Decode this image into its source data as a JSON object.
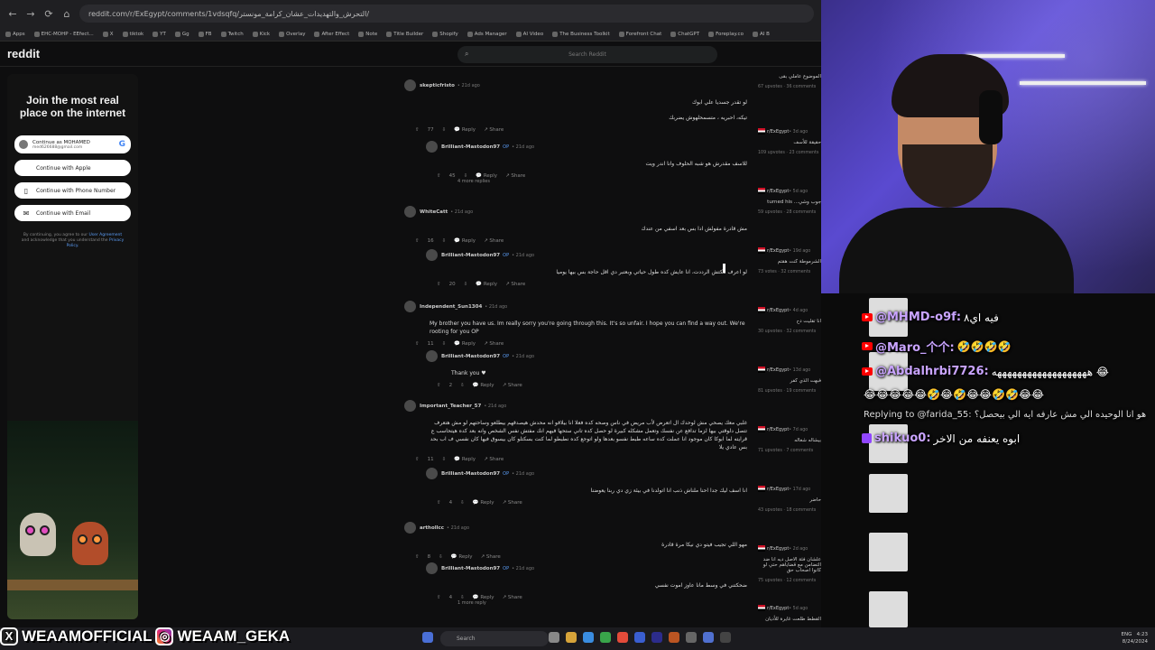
{
  "browser": {
    "url": "reddit.com/r/ExEgypt/comments/1vdsqfq/التحرش_والتهديدات_عشان_كرامة_مونستر/",
    "bookmarks": [
      "Apps",
      "EHC-MOHP - EEfect...",
      "X",
      "tiktok",
      "YT",
      "Gg",
      "FB",
      "Twitch",
      "Kick",
      "Overlay",
      "After Effect",
      "Note",
      "Title Builder",
      "Shopify",
      "Ads Manager",
      "AI Video",
      "The Business Toolkit",
      "Forefront Chat",
      "ChatGPT",
      "Foreplay.co",
      "AI B"
    ]
  },
  "reddit": {
    "logo": "reddit",
    "search_placeholder": "Search Reddit",
    "join": {
      "title": "Join the most real place on the internet",
      "google_name": "Continue as MOHAMED",
      "google_email": "med626688@gmail.com",
      "apple": "Continue with Apple",
      "phone": "Continue with Phone Number",
      "email": "Continue with Email",
      "terms_1": "By continuing, you agree to our",
      "terms_user": "User Agreement",
      "terms_2": "and acknowledge that you understand the",
      "terms_privacy": "Privacy Policy."
    },
    "comments": [
      {
        "user": "skepticfristo",
        "time": "• 21d ago",
        "body": "لو تقدر جسديا علي ابوك",
        "body2": "تيكه، احبريه ، متسمحلهوش يضربك",
        "votes": "77",
        "reply_label": "Reply",
        "share_label": "Share",
        "reply": {
          "user": "Brilliant-Mastodon97",
          "op": "OP",
          "time": "• 21d ago",
          "body": "للاسف مقدرش هو شبه الحلوف وانا اندر ويت",
          "votes": "45",
          "more": "4 more replies"
        }
      },
      {
        "user": "WhiteCatt",
        "time": "• 21d ago",
        "body": "مش قادرة مفولش ادا بس بعد اسفي من عندك",
        "votes": "16",
        "reply": {
          "user": "Brilliant-Mastodon97",
          "op": "OP",
          "time": "• 21d ago",
          "body": "لو اعرف مكتش الرددت، انا عايش كده طول حياتي وبعتبر دي اقل حاجة بس بيها يوميا",
          "votes": "20"
        }
      },
      {
        "user": "Independent_Sun1304",
        "time": "• 21d ago",
        "body": "My brother you have us. Im really sorry you're going through this. It's so unfair. I hope you can find a way out. We're rooting for you OP",
        "votes": "11",
        "reply": {
          "user": "Brilliant-Mastodon97",
          "op": "OP",
          "time": "• 21d ago",
          "body": "Thank you ♥",
          "votes": "2"
        }
      },
      {
        "user": "Important_Teacher_57",
        "time": "• 21d ago",
        "body": "غلبي معك يصحي مش لوحدك ال اتعرض لأب مريض في ناس وصحه كده فعلا انا بيلاقو انه محدش هيصدقهم بيطلعو وساحتهم لو مش هتعرف تتصل دلوقتي بيها لزما تدافع عن نفسك وتعمل مشكله كبيرة لو حصل كده تاني ستحها فيهم انك مفتش نفس الشخص وانه بعد كده هيتحاسب ع قرايته لما ابوكا كان موجود انا عملت كده ساعه طبط نفسو بعدها ولو اتوجع كده نطبطو لما كنت بسكتلو كان بيسوق فيها كان نفسي ف اب بحد بس عادي يلا",
        "votes": "11",
        "reply": {
          "user": "Brilliant-Mastodon97",
          "op": "OP",
          "time": "• 21d ago",
          "body": "انا اسف ليك جدا احنا ملناش ذنب انا اتولدنا في بيئة زي دي ربنا يعوضنا",
          "votes": "4"
        }
      },
      {
        "user": "arthollcc",
        "time": "• 21d ago",
        "body": "مهو اللي تجيب فيتو دي نيكا مرة قادرة",
        "votes": "8",
        "reply": {
          "user": "Brilliant-Mastodon97",
          "op": "OP",
          "time": "• 21d ago",
          "body": "ضحكتني في وسط مانا عاوز اموت نفسي",
          "votes": "4",
          "more": "1 more reply"
        }
      }
    ],
    "sidebar": [
      {
        "title": "الموضوع عاملي بقى",
        "meta": "67 upvotes · 36 comments"
      },
      {
        "sub": "r/ExEgypt",
        "time": "• 3d ago",
        "title": "حقيقة للأسف",
        "meta": "109 upvotes · 23 comments"
      },
      {
        "sub": "r/ExEgypt",
        "time": "• 5d ago",
        "title": "turned his ...جوب وشي",
        "meta": "59 upvotes · 28 comments"
      },
      {
        "sub": "r/ExEgypt",
        "time": "• 19d ago",
        "title": "الشرموطة كنت هقتم",
        "meta": "73 votes · 32 comments"
      },
      {
        "sub": "r/ExEgypt",
        "time": "• 4d ago",
        "title": "انا تقليت دح",
        "meta": "30 upvotes · 32 comments"
      },
      {
        "sub": "r/ExEgypt",
        "time": "• 13d ago",
        "title": "فبهت الذي كفر",
        "meta": "81 upvotes · 19 comments"
      },
      {
        "sub": "r/ExEgypt",
        "time": "• 7d ago",
        "title": "بيشاله شغاله",
        "meta": "71 upvotes · 7 comments"
      },
      {
        "sub": "r/ExEgypt",
        "time": "• 17d ago",
        "title": "حاضر",
        "meta": "43 upvotes · 18 comments"
      },
      {
        "sub": "r/ExEgypt",
        "time": "• 2d ago",
        "title": "علشان فئة الاصل ديه انا ضد التضامن مع قضاياهم حتي لو كانوا اصحاب حق",
        "meta": "75 upvotes · 12 comments"
      },
      {
        "sub": "r/ExEgypt",
        "time": "• 5d ago",
        "title": "القطط طلعت غايرة للأديان",
        "meta": ""
      }
    ]
  },
  "chat": [
    {
      "user": "@MHMD-o9f:",
      "text": "فيه اي٨",
      "platform": "yt"
    },
    {
      "user": "@Maro_个个:",
      "text": "🤣🤣🤣🤣",
      "platform": "yt"
    },
    {
      "user": "@Abdalhrbi7726:",
      "text": "هههههههههههههههههههه 😂",
      "platform": "yt"
    },
    {
      "user": "",
      "text": "😂😂😂😂😂🤣😂🤣😂😂🤣🤣😂😂",
      "platform": ""
    },
    {
      "user": "",
      "text": "Replying to @farida_55: هو انا الوحيده الي مش عارفه ايه الي بيحصل؟",
      "platform": ""
    },
    {
      "user": "shikuo0:",
      "text": "ابوه يعنفه من الاخر",
      "platform": "tw"
    }
  ],
  "overlay": {
    "x_handle": "WEAAMOFFICIAL",
    "ig_handle": "WEAAM_GEKA"
  },
  "taskbar": {
    "search": "Search",
    "lang": "ENG",
    "clock": "4:23",
    "date": "8/24/2024"
  }
}
